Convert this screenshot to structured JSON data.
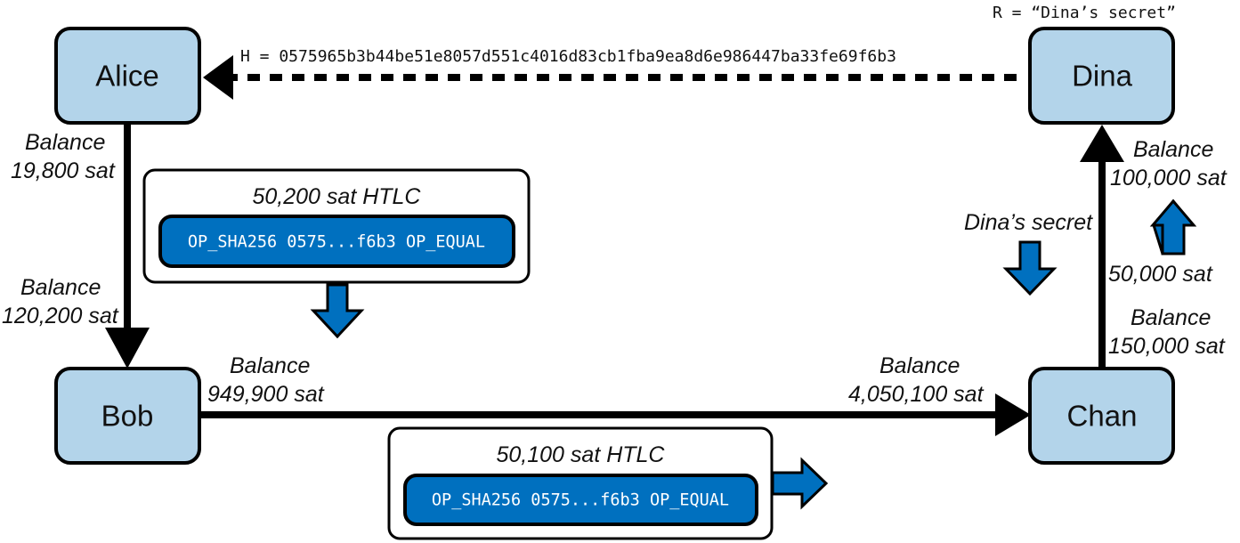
{
  "nodes": {
    "alice": {
      "label": "Alice"
    },
    "bob": {
      "label": "Bob"
    },
    "chan": {
      "label": "Chan"
    },
    "dina": {
      "label": "Dina"
    }
  },
  "hash_label": "H = 0575965b3b44be51e8057d551c4016d83cb1fba9ea8d6e986447ba33fe69f6b3",
  "secret_label": "R = “Dina’s secret”",
  "channels": {
    "alice_bob": {
      "alice_side": {
        "title": "Balance",
        "value": "19,800 sat"
      },
      "bob_side": {
        "title": "Balance",
        "value": "120,200 sat"
      }
    },
    "bob_chan": {
      "bob_side": {
        "title": "Balance",
        "value": "949,900 sat"
      },
      "chan_side": {
        "title": "Balance",
        "value": "4,050,100 sat"
      }
    },
    "chan_dina": {
      "chan_side": {
        "title": "Balance",
        "value": "150,000 sat"
      },
      "dina_side": {
        "title": "Balance",
        "value": "100,000 sat"
      },
      "transfer": "50,000 sat",
      "secret_flow": "Dina’s secret"
    }
  },
  "htlcs": [
    {
      "title": "50,200 sat HTLC",
      "script": "OP_SHA256 0575...f6b3 OP_EQUAL"
    },
    {
      "title": "50,100 sat HTLC",
      "script": "OP_SHA256 0575...f6b3 OP_EQUAL"
    }
  ],
  "colors": {
    "node_fill": "#b3d4ea",
    "script_fill": "#0070bf",
    "arrow_fill": "#0070bf"
  }
}
